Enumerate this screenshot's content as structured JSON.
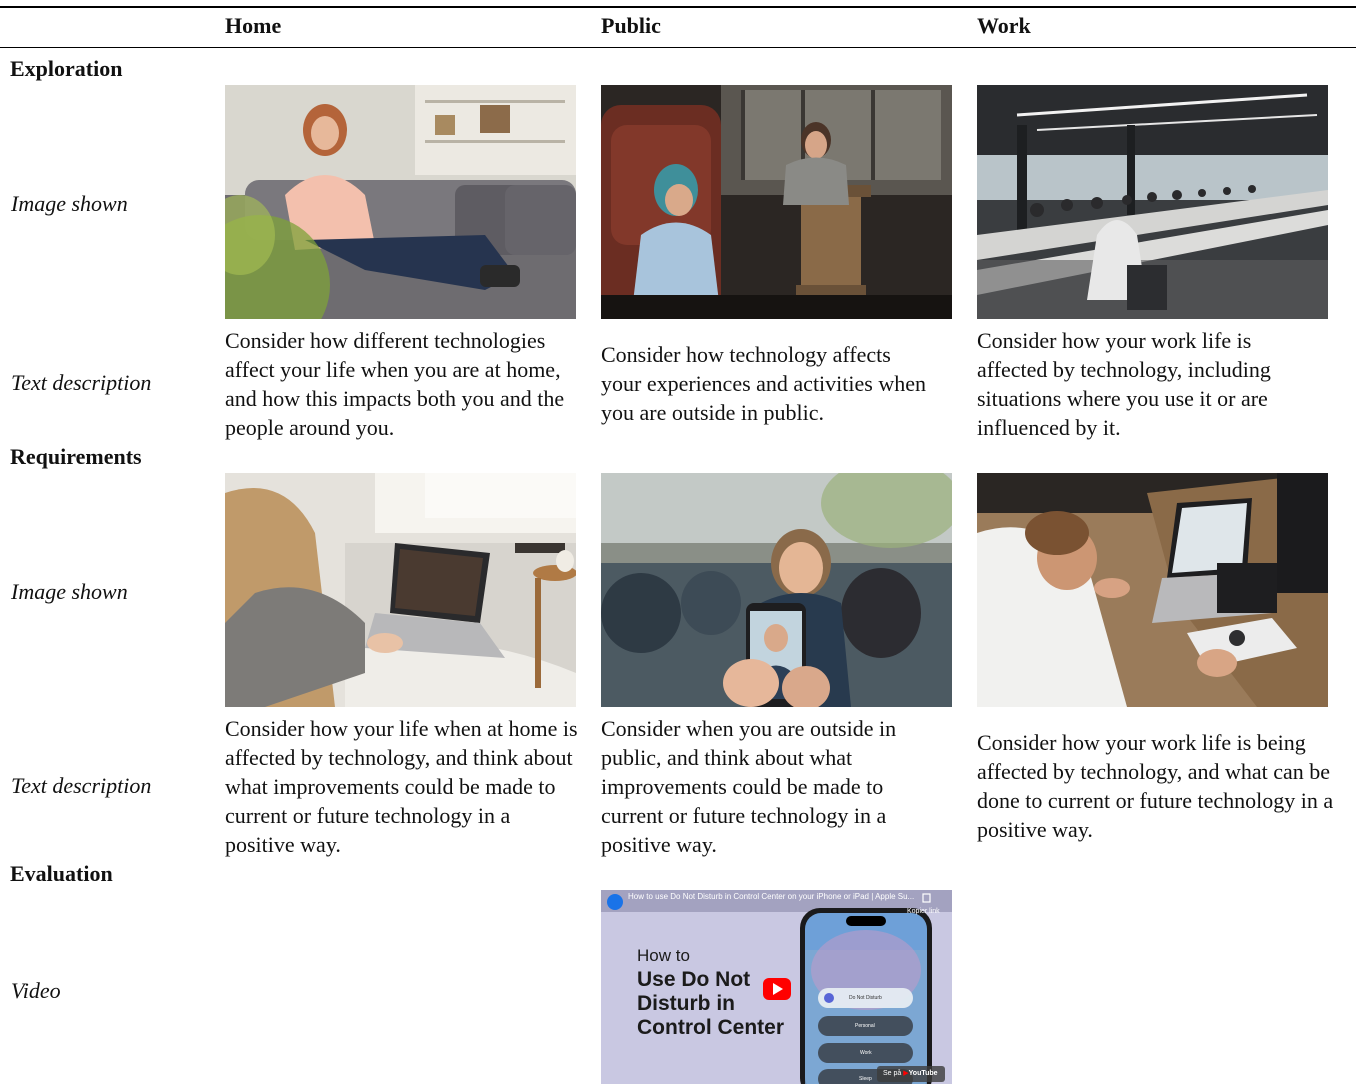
{
  "table": {
    "columns": [
      "Home",
      "Public",
      "Work"
    ],
    "sections": {
      "exploration": {
        "title": "Exploration",
        "image_label": "Image shown",
        "text_label": "Text description",
        "descriptions": [
          "Consider how different technologies affect your life when you are at home, and how this impacts both you and the people around you.",
          "Consider how technology affects your experiences and activities when you are outside in public.",
          "Consider how your work life is affected by technology, including situations where you use it or are influenced by it."
        ]
      },
      "requirements": {
        "title": "Requirements",
        "image_label": "Image shown",
        "text_label": "Text description",
        "descriptions": [
          "Consider how your life when at home is affected by technology, and think about what improvements could be made to current or future technology in a positive way.",
          "Consider when you are outside in public, and think about what improvements could be made to current or future technology in a positive way.",
          "Consider how your work life is being affected by technology, and what can be done to current or future technology in a positive way."
        ]
      },
      "evaluation": {
        "title": "Evaluation",
        "video_label": "Video"
      }
    }
  },
  "video": {
    "title_bar": "How to use Do Not Disturb in Control Center on your iPhone or iPad | Apple Su...",
    "copy_label": "Kopier link",
    "how_to": "How to",
    "headline": "Use Do Not Disturb in Control Center",
    "controls": [
      "Do Not Disturb",
      "Personal",
      "Work",
      "Sleep"
    ],
    "watch_on": "Se på",
    "brand": "YouTube"
  },
  "colors": {
    "rule": "#000000",
    "video_bg": "#c9c8e2",
    "youtube_red": "#ff0000"
  }
}
